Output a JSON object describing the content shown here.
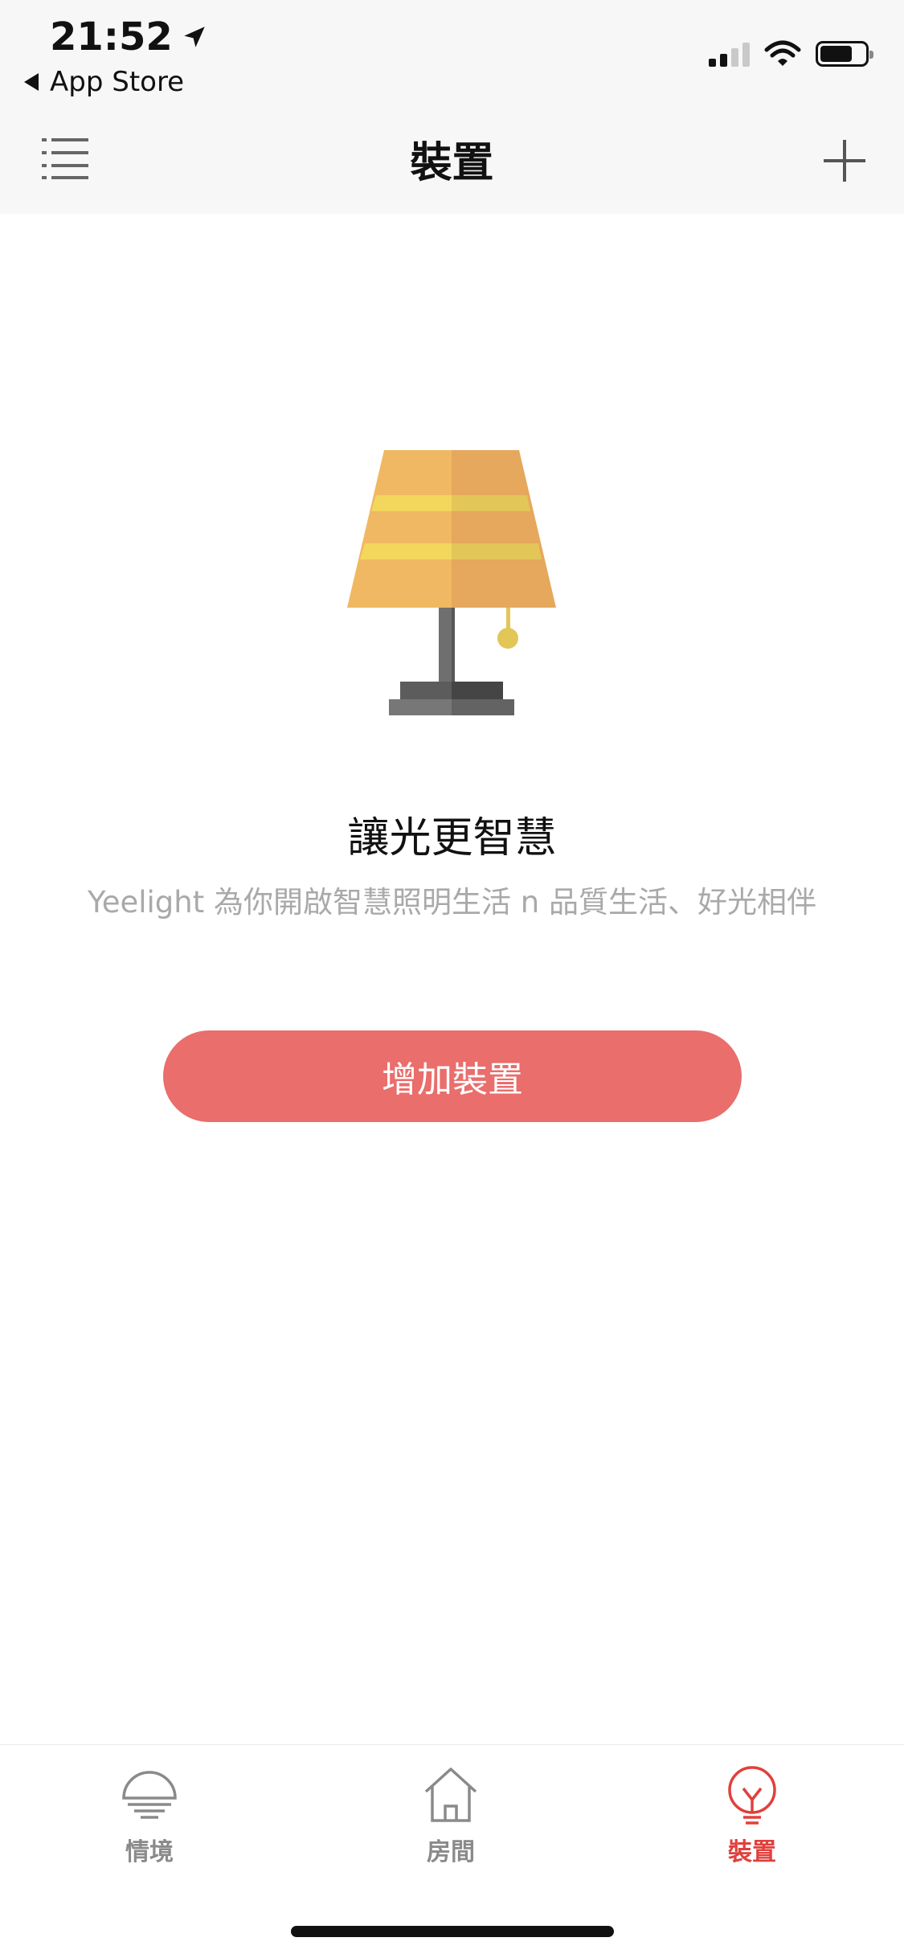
{
  "status_bar": {
    "time": "21:52",
    "back_app": "App Store",
    "icons": [
      "location-arrow-icon",
      "signal-icon",
      "wifi-icon",
      "battery-icon"
    ]
  },
  "nav": {
    "title": "裝置",
    "menu_icon": "menu-list-icon",
    "add_icon": "plus-icon"
  },
  "empty_state": {
    "illustration": "table-lamp-illustration",
    "headline": "讓光更智慧",
    "subtext": "Yeelight 為你開啟智慧照明生活 n 品質生活、好光相伴",
    "button_label": "增加裝置"
  },
  "tabbar": {
    "items": [
      {
        "label": "情境",
        "icon": "scene-lamp-icon",
        "active": false
      },
      {
        "label": "房間",
        "icon": "house-icon",
        "active": false
      },
      {
        "label": "裝置",
        "icon": "bulb-icon",
        "active": true
      }
    ]
  },
  "colors": {
    "accent": "#e96e6c",
    "active_tab": "#e0403c",
    "inactive_tab": "#8a8a8a",
    "lamp_shade": "#f0b862",
    "lamp_stripe": "#f2d75c"
  }
}
